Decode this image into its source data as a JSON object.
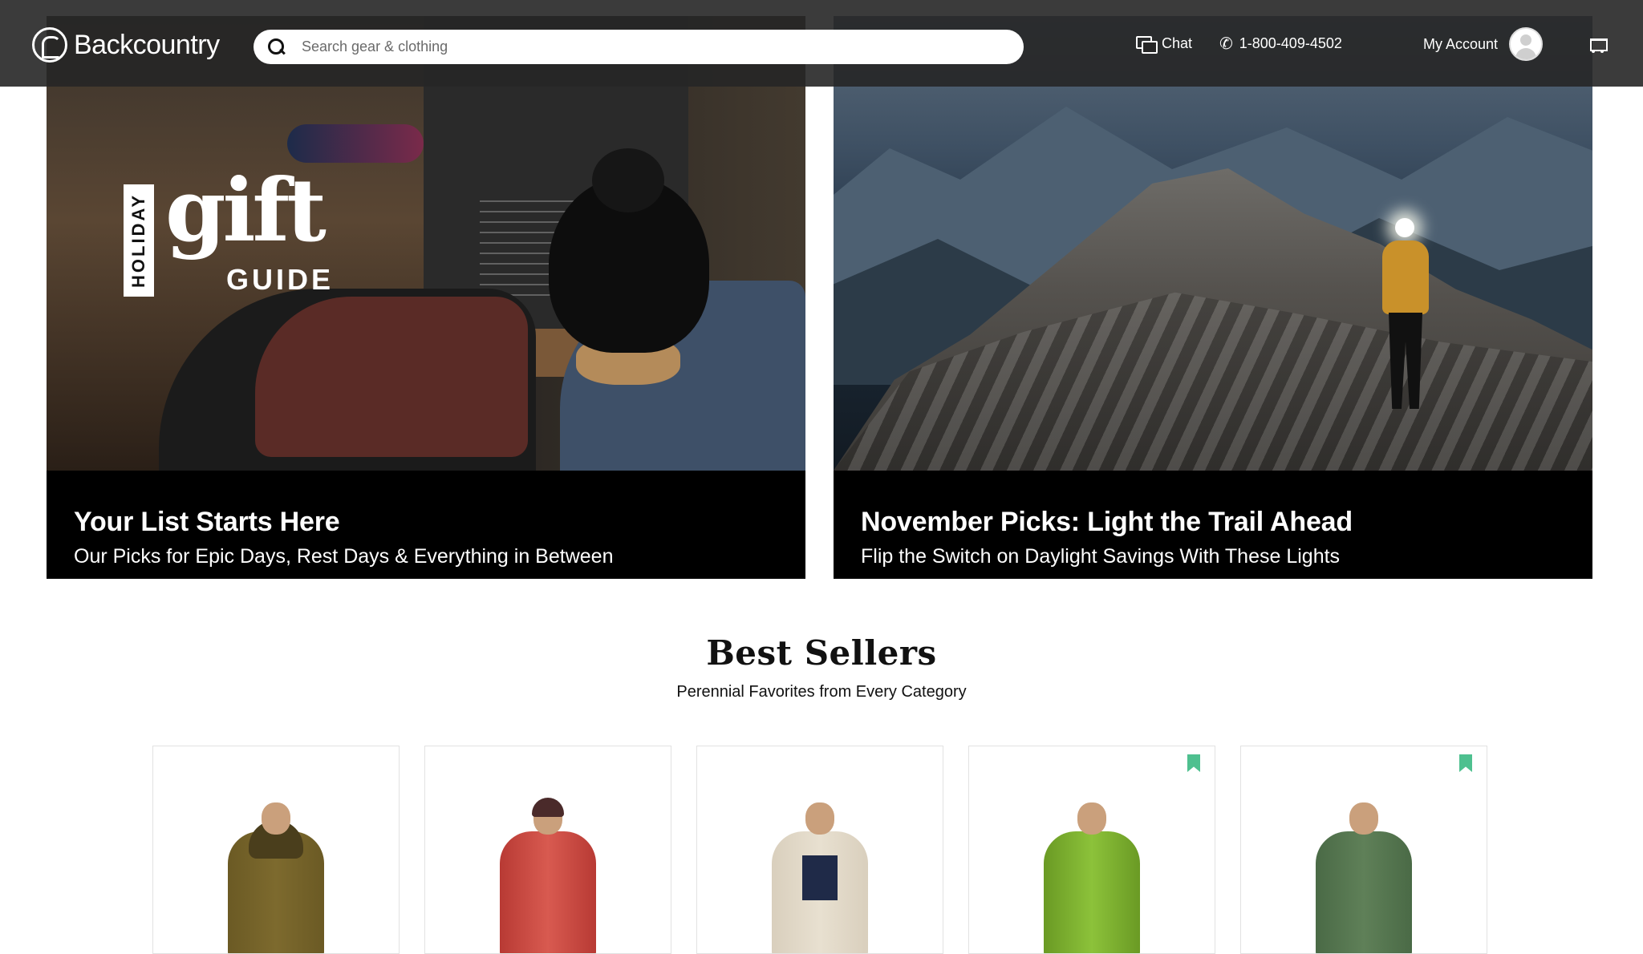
{
  "header": {
    "logo_text": "Backcountry",
    "search_placeholder": "Search gear & clothing",
    "chat_label": "Chat",
    "phone_label": "1-800-409-4502",
    "account_label": "My Account"
  },
  "hero": [
    {
      "title": "Your List Starts Here",
      "subtitle": "Our Picks for Epic Days, Rest Days & Everything in Between",
      "logo_holiday": "HOLIDAY",
      "logo_gift": "gift",
      "logo_guide": "GUIDE"
    },
    {
      "title": "November Picks: Light the Trail Ahead",
      "subtitle": "Flip the Switch on Daylight Savings With These Lights"
    }
  ],
  "best_sellers": {
    "title": "Best Sellers",
    "subtitle": "Perennial Favorites from Every Category",
    "products": [
      {
        "color": "#6b5a24",
        "bookmarked": false
      },
      {
        "color": "#c84a42",
        "bookmarked": false
      },
      {
        "color": "#e0d6c6",
        "bookmarked": false
      },
      {
        "color": "#7cb22f",
        "bookmarked": true
      },
      {
        "color": "#557550",
        "bookmarked": true
      }
    ]
  },
  "colors": {
    "header_bg": "#262626",
    "bookmark": "#4ec08f",
    "caption_bg": "#000000"
  },
  "icons": {
    "logo": "backcountry-goat-icon",
    "search": "search-icon",
    "chat": "chat-bubbles-icon",
    "phone": "phone-icon",
    "account": "avatar-icon",
    "cart": "cart-icon",
    "bookmark": "bookmark-icon"
  }
}
